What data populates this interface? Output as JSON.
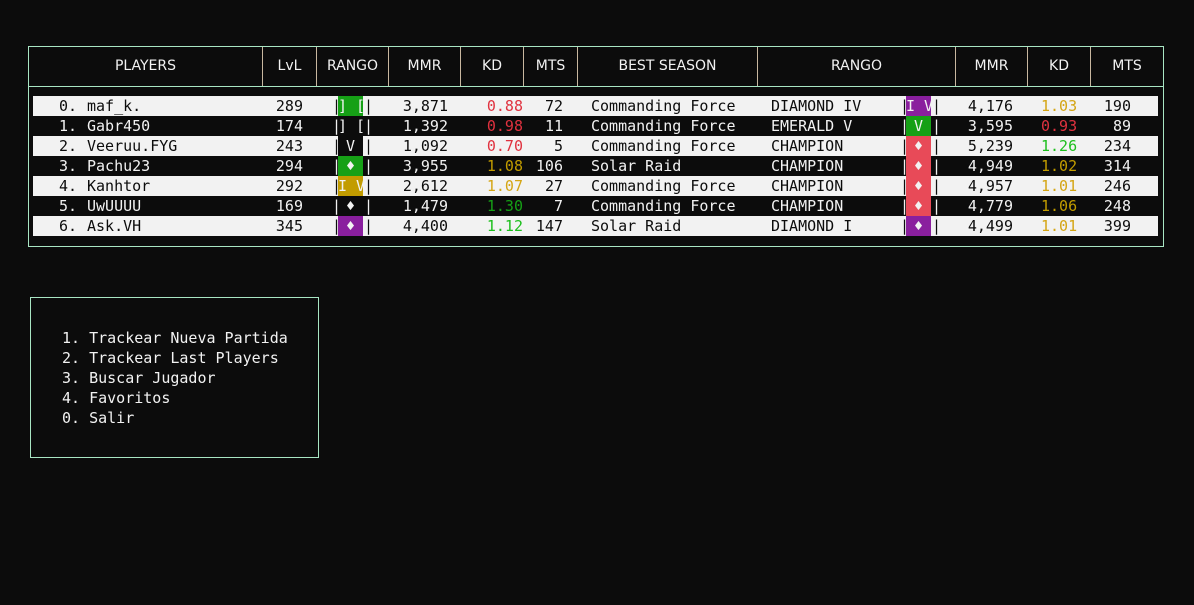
{
  "headers": [
    "PLAYERS",
    "LvL",
    "RANGO",
    "MMR",
    "KD",
    "MTS",
    "BEST SEASON",
    "RANGO",
    "MMR",
    "KD",
    "MTS"
  ],
  "rows": [
    {
      "idx": "0.",
      "name": "maf_k.",
      "lvl": "289",
      "rank_glyph": "] [",
      "rank_color": "#16a016",
      "mmr": "3,871",
      "kd": "0.88",
      "kd_color": "#e0323f",
      "mts": "72",
      "season": "Commanding Force",
      "best_rank": "DIAMOND IV",
      "best_glyph": "I V",
      "best_color": "#8a1f9e",
      "best_mmr": "4,176",
      "best_kd": "1.03",
      "best_kd_color": "#d4a514",
      "best_mts": "190"
    },
    {
      "idx": "1.",
      "name": "Gabr450",
      "lvl": "174",
      "rank_glyph": "] [",
      "rank_color": "",
      "mmr": "1,392",
      "kd": "0.98",
      "kd_color": "#e0323f",
      "mts": "11",
      "season": "Commanding Force",
      "best_rank": "EMERALD V",
      "best_glyph": "V",
      "best_color": "#16a016",
      "best_mmr": "3,595",
      "best_kd": "0.93",
      "best_kd_color": "#e0323f",
      "best_mts": "89"
    },
    {
      "idx": "2.",
      "name": "Veeruu.FYG",
      "lvl": "243",
      "rank_glyph": "V",
      "rank_color": "#0c0c0c",
      "mmr": "1,092",
      "kd": "0.70",
      "kd_color": "#e0323f",
      "mts": "5",
      "season": "Commanding Force",
      "best_rank": "CHAMPION",
      "best_glyph": "♦",
      "best_color": "#e84a58",
      "best_mmr": "5,239",
      "best_kd": "1.26",
      "best_kd_color": "#1cbf1c",
      "best_mts": "234"
    },
    {
      "idx": "3.",
      "name": "Pachu23",
      "lvl": "294",
      "rank_glyph": "♦",
      "rank_color": "#16a016",
      "mmr": "3,955",
      "kd": "1.08",
      "kd_color": "#c29c00",
      "mts": "106",
      "season": "Solar Raid",
      "best_rank": "CHAMPION",
      "best_glyph": "♦",
      "best_color": "#e84a58",
      "best_mmr": "4,949",
      "best_kd": "1.02",
      "best_kd_color": "#c29c00",
      "best_mts": "314"
    },
    {
      "idx": "4.",
      "name": "Kanhtor",
      "lvl": "292",
      "rank_glyph": "I V",
      "rank_color": "#c29c00",
      "mmr": "2,612",
      "kd": "1.07",
      "kd_color": "#d4a514",
      "mts": "27",
      "season": "Commanding Force",
      "best_rank": "CHAMPION",
      "best_glyph": "♦",
      "best_color": "#e84a58",
      "best_mmr": "4,957",
      "best_kd": "1.01",
      "best_kd_color": "#d4a514",
      "best_mts": "246"
    },
    {
      "idx": "5.",
      "name": "UwUUUU",
      "lvl": "169",
      "rank_glyph": "♦",
      "rank_color": "",
      "mmr": "1,479",
      "kd": "1.30",
      "kd_color": "#16a016",
      "mts": "7",
      "season": "Commanding Force",
      "best_rank": "CHAMPION",
      "best_glyph": "♦",
      "best_color": "#e84a58",
      "best_mmr": "4,779",
      "best_kd": "1.06",
      "best_kd_color": "#c29c00",
      "best_mts": "248"
    },
    {
      "idx": "6.",
      "name": "Ask.VH",
      "lvl": "345",
      "rank_glyph": "♦",
      "rank_color": "#8a1f9e",
      "mmr": "4,400",
      "kd": "1.12",
      "kd_color": "#1cbf1c",
      "mts": "147",
      "season": "Solar Raid",
      "best_rank": "DIAMOND I",
      "best_glyph": "♦",
      "best_color": "#8a1f9e",
      "best_mmr": "4,499",
      "best_kd": "1.01",
      "best_kd_color": "#d4a514",
      "best_mts": "399"
    }
  ],
  "menu": [
    "1. Trackear Nueva Partida",
    "2. Trackear Last Players",
    "3. Buscar Jugador",
    "4. Favoritos",
    "0. Salir"
  ],
  "bar_char": "|"
}
